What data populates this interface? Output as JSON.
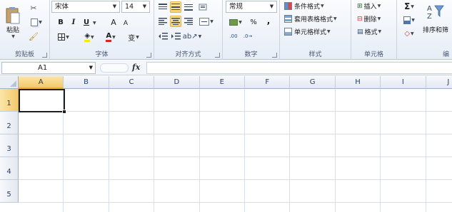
{
  "ribbon": {
    "clipboard": {
      "label": "剪贴板",
      "paste_label": "粘贴"
    },
    "font": {
      "label": "字体",
      "font_name": "宋体",
      "font_size": "14",
      "bold": "B",
      "italic": "I",
      "underline": "U",
      "grow": "A",
      "shrink": "A",
      "font_color": "A",
      "phonetic": "变"
    },
    "alignment": {
      "label": "对齐方式"
    },
    "number": {
      "label": "数字",
      "format": "常规",
      "percent": "%",
      "comma": ",",
      "decimals": ".00"
    },
    "styles": {
      "label": "样式",
      "conditional": "条件格式",
      "as_table": "套用表格格式",
      "cell_styles": "单元格样式"
    },
    "cells": {
      "label": "单元格",
      "insert": "插入",
      "delete": "删除",
      "format": "格式"
    },
    "editing": {
      "sigma": "Σ",
      "sort_filter": "排序和筛",
      "partial_label": "编"
    }
  },
  "formula_bar": {
    "name_box": "A1",
    "fx": "fx",
    "formula": ""
  },
  "grid": {
    "columns": [
      "A",
      "B",
      "C",
      "D",
      "E",
      "F",
      "G",
      "H",
      "I",
      "J"
    ],
    "rows": [
      "1",
      "2",
      "3",
      "4",
      "5"
    ],
    "selected_cell": "A1"
  },
  "colors": {
    "accent": "#f4c869",
    "grid_line": "#dadfe6",
    "header_text": "#27416a"
  }
}
